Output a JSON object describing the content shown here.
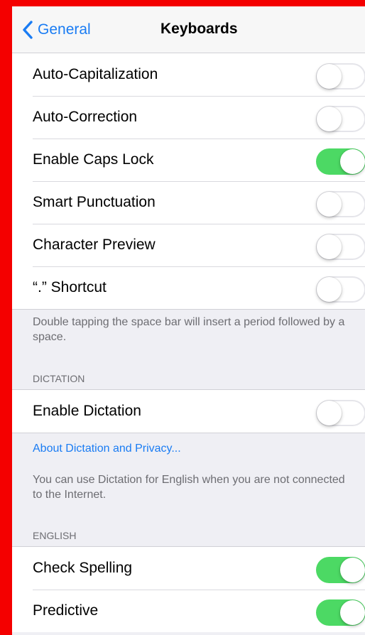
{
  "navbar": {
    "back_label": "General",
    "title": "Keyboards"
  },
  "main_settings": [
    {
      "label": "Auto-Capitalization",
      "on": false
    },
    {
      "label": "Auto-Correction",
      "on": false
    },
    {
      "label": "Enable Caps Lock",
      "on": true
    },
    {
      "label": "Smart Punctuation",
      "on": false
    },
    {
      "label": "Character Preview",
      "on": false
    },
    {
      "label": "“.” Shortcut",
      "on": false
    }
  ],
  "shortcut_footnote": "Double tapping the space bar will insert a period followed by a space.",
  "dictation": {
    "header": "DICTATION",
    "enable_label": "Enable Dictation",
    "enable_on": false,
    "privacy_link": "About Dictation and Privacy...",
    "footnote": "You can use Dictation for English when you are not connected to the Internet."
  },
  "english": {
    "header": "ENGLISH",
    "items": [
      {
        "label": "Check Spelling",
        "on": true
      },
      {
        "label": "Predictive",
        "on": true
      }
    ]
  },
  "colors": {
    "accent": "#1a7cf3",
    "switch_on": "#4cd964",
    "frame_border": "#f40000",
    "background": "#efeff4"
  },
  "icons": {
    "back": "chevron-left-icon"
  }
}
